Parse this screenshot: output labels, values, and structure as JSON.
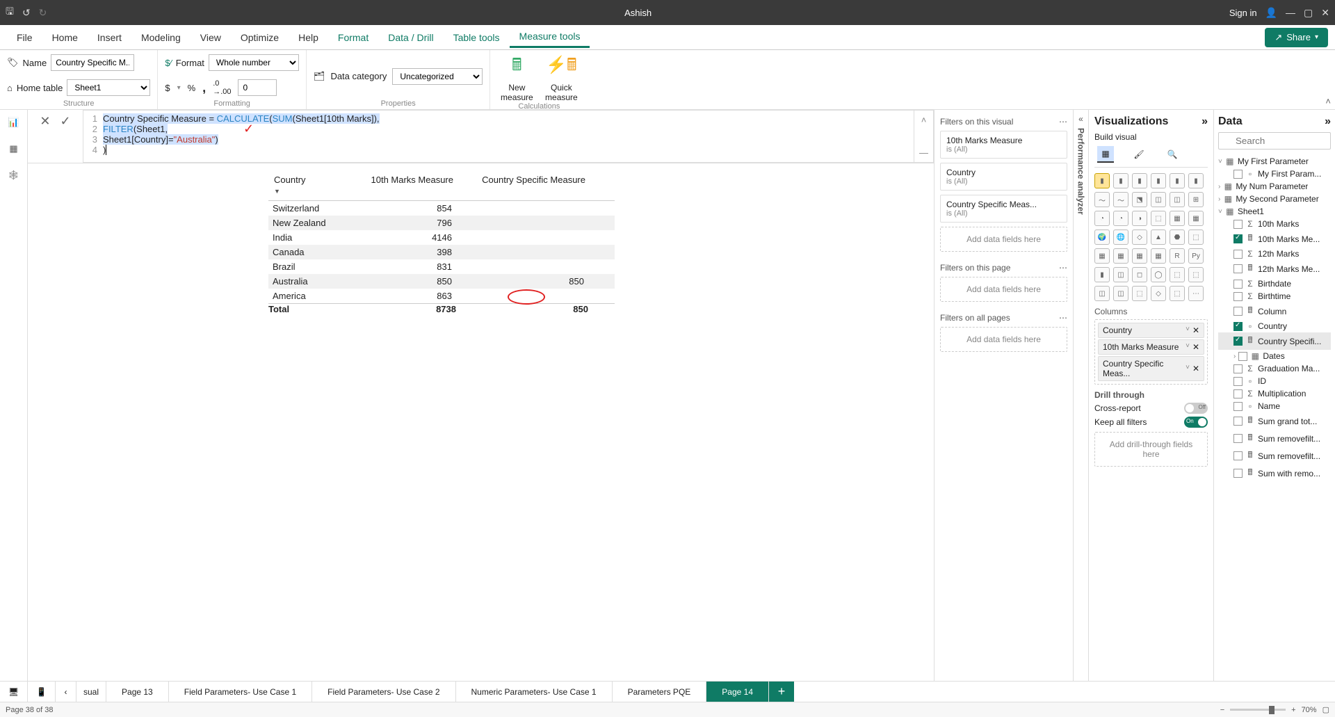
{
  "titlebar": {
    "title": "Ashish",
    "signin": "Sign in"
  },
  "ribbonTabs": [
    "File",
    "Home",
    "Insert",
    "Modeling",
    "View",
    "Optimize",
    "Help",
    "Format",
    "Data / Drill",
    "Table tools",
    "Measure tools"
  ],
  "activeRibbonTab": 10,
  "greenTabs": [
    7,
    8,
    9,
    10
  ],
  "share": "Share",
  "structure": {
    "label": "Structure",
    "nameLabel": "Name",
    "nameValue": "Country Specific M...",
    "homeLabel": "Home table",
    "homeValue": "Sheet1"
  },
  "formatting": {
    "label": "Formatting",
    "formatLabel": "Format",
    "formatValue": "Whole number",
    "dollar": "$",
    "percent": "%",
    "comma": ",",
    "decInc": ".0",
    "decDec": ".00",
    "decimals": "0"
  },
  "properties": {
    "label": "Properties",
    "dataCat": "Data category",
    "dataCatValue": "Uncategorized"
  },
  "calculations": {
    "label": "Calculations",
    "new1": "New",
    "new2": "measure",
    "quick1": "Quick",
    "quick2": "measure"
  },
  "formula": {
    "checkX": "✕",
    "checkV": "✓",
    "lines": [
      {
        "n": "1",
        "raw": "Country Specific Measure = CALCULATE(SUM(Sheet1[10th Marks]),"
      },
      {
        "n": "2",
        "raw": "FILTER(Sheet1,"
      },
      {
        "n": "3",
        "raw": "Sheet1[Country]=\"Australia\")"
      },
      {
        "n": "4",
        "raw": ")"
      }
    ]
  },
  "table": {
    "cols": [
      "Country",
      "10th Marks Measure",
      "Country Specific Measure"
    ],
    "rows": [
      [
        "Switzerland",
        "854",
        ""
      ],
      [
        "New Zealand",
        "796",
        ""
      ],
      [
        "India",
        "4146",
        ""
      ],
      [
        "Canada",
        "398",
        ""
      ],
      [
        "Brazil",
        "831",
        ""
      ],
      [
        "Australia",
        "850",
        "850"
      ],
      [
        "America",
        "863",
        ""
      ]
    ],
    "total": [
      "Total",
      "8738",
      "850"
    ]
  },
  "filters": {
    "visual": {
      "title": "Filters on this visual",
      "cards": [
        {
          "t": "10th Marks Measure",
          "s": "is (All)"
        },
        {
          "t": "Country",
          "s": "is (All)"
        },
        {
          "t": "Country Specific Meas...",
          "s": "is (All)"
        }
      ],
      "drop": "Add data fields here"
    },
    "page": {
      "title": "Filters on this page",
      "drop": "Add data fields here"
    },
    "all": {
      "title": "Filters on all pages",
      "drop": "Add data fields here"
    }
  },
  "perf": "Performance analyzer",
  "viz": {
    "title": "Visualizations",
    "build": "Build visual",
    "columns": "Columns",
    "wells": [
      "Country",
      "10th Marks Measure",
      "Country Specific Meas..."
    ],
    "drill": "Drill through",
    "cross": "Cross-report",
    "crossState": "Off",
    "keep": "Keep all filters",
    "keepState": "On",
    "drillDrop": "Add drill-through fields here"
  },
  "data": {
    "title": "Data",
    "searchPh": "Search",
    "tree": [
      {
        "t": "My First Parameter",
        "kind": "table",
        "exp": true
      },
      {
        "t": "My First Param...",
        "kind": "field",
        "child": true
      },
      {
        "t": "My Num Parameter",
        "kind": "table",
        "exp": false
      },
      {
        "t": "My Second Parameter",
        "kind": "table",
        "exp": false
      },
      {
        "t": "Sheet1",
        "kind": "table",
        "exp": true
      },
      {
        "t": "10th Marks",
        "kind": "sum",
        "child": true
      },
      {
        "t": "10th Marks Me...",
        "kind": "measure",
        "child": true,
        "chk": true
      },
      {
        "t": "12th Marks",
        "kind": "sum",
        "child": true
      },
      {
        "t": "12th Marks Me...",
        "kind": "measure",
        "child": true
      },
      {
        "t": "Birthdate",
        "kind": "sum",
        "child": true
      },
      {
        "t": "Birthtime",
        "kind": "sum",
        "child": true
      },
      {
        "t": "Column",
        "kind": "measure",
        "child": true
      },
      {
        "t": "Country",
        "kind": "field",
        "child": true,
        "chk": true
      },
      {
        "t": "Country Specifi...",
        "kind": "measure",
        "child": true,
        "chk": true,
        "sel": true
      },
      {
        "t": "Dates",
        "kind": "hier",
        "child": true,
        "car": true
      },
      {
        "t": "Graduation Ma...",
        "kind": "sum",
        "child": true
      },
      {
        "t": "ID",
        "kind": "field",
        "child": true
      },
      {
        "t": "Multiplication",
        "kind": "sum",
        "child": true
      },
      {
        "t": "Name",
        "kind": "field",
        "child": true
      },
      {
        "t": "Sum grand tot...",
        "kind": "measure",
        "child": true
      },
      {
        "t": "Sum removefilt...",
        "kind": "measure",
        "child": true
      },
      {
        "t": "Sum removefilt...",
        "kind": "measure",
        "child": true
      },
      {
        "t": "Sum with remo...",
        "kind": "measure",
        "child": true
      }
    ]
  },
  "pages": {
    "partial": "sual",
    "tabs": [
      "Page 13",
      "Field Parameters- Use Case 1",
      "Field Parameters- Use Case 2",
      "Numeric Parameters- Use Case 1",
      "Parameters PQE",
      "Page 14"
    ],
    "active": 5
  },
  "status": {
    "left": "Page 38 of 38",
    "zoom": "70%"
  }
}
